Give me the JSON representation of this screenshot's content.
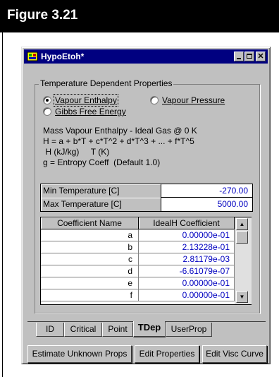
{
  "figure": {
    "title": "Figure 3.21"
  },
  "window": {
    "title": "HypoEtoh*",
    "controls": {
      "minimize": "minimize-icon",
      "maximize": "maximize-icon",
      "close": "close-icon"
    }
  },
  "group": {
    "label": "Temperature Dependent Properties",
    "radios": [
      {
        "label": "Vapour Enthalpy",
        "checked": true
      },
      {
        "label": "Vapour Pressure",
        "checked": false
      },
      {
        "label": "Gibbs Free Energy",
        "checked": false
      }
    ],
    "info_lines": [
      "Mass Vapour Enthalpy - Ideal Gas @ 0 K",
      "H = a + b*T + c*T^2 + d*T^3 + ... + f*T^5",
      " H (kJ/kg)     T (K)",
      "g = Entropy Coeff  (Default 1.0)"
    ],
    "range": [
      {
        "label": "Min Temperature [C]",
        "value": "-270.00"
      },
      {
        "label": "Max Temperature [C]",
        "value": "5000.00"
      }
    ],
    "coefficients": {
      "headers": [
        "Coefficient Name",
        "IdealH Coefficient"
      ],
      "rows": [
        {
          "name": "a",
          "value": "0.00000e-01"
        },
        {
          "name": "b",
          "value": "2.13228e-01"
        },
        {
          "name": "c",
          "value": "2.81179e-03"
        },
        {
          "name": "d",
          "value": "-6.61079e-07"
        },
        {
          "name": "e",
          "value": "0.00000e-01"
        },
        {
          "name": "f",
          "value": "0.00000e-01"
        }
      ]
    }
  },
  "tabs": [
    {
      "label": "ID",
      "active": false
    },
    {
      "label": "Critical",
      "active": false
    },
    {
      "label": "Point",
      "active": false
    },
    {
      "label": "TDep",
      "active": true
    },
    {
      "label": "UserProp",
      "active": false
    }
  ],
  "buttons": {
    "estimate": "Estimate Unknown Props",
    "edit_properties": "Edit Properties",
    "edit_visc": "Edit Visc Curve"
  },
  "colors": {
    "titlebar": "#000080",
    "value_text": "#0000c0",
    "dialog": "#c0c0c0"
  }
}
